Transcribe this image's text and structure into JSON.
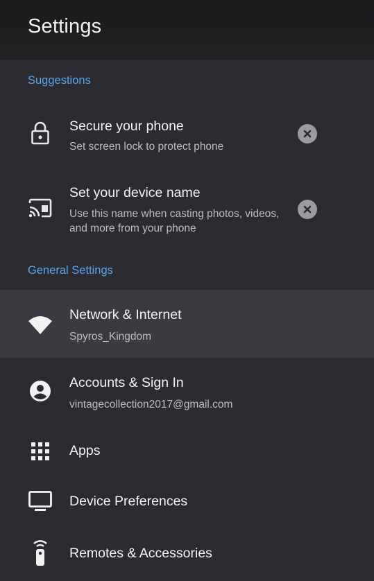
{
  "page": {
    "title": "Settings"
  },
  "suggestions": {
    "header": "Suggestions",
    "items": [
      {
        "title": "Secure your phone",
        "subtitle": "Set screen lock to protect phone",
        "icon": "lock-icon"
      },
      {
        "title": "Set your device name",
        "subtitle": "Use this name when casting photos, videos, and more from your phone",
        "icon": "cast-icon"
      }
    ]
  },
  "general": {
    "header": "General Settings",
    "items": [
      {
        "title": "Network & Internet",
        "subtitle": "Spyros_Kingdom",
        "icon": "wifi-icon"
      },
      {
        "title": "Accounts & Sign In",
        "subtitle": "vintagecollection2017@gmail.com",
        "icon": "account-icon"
      },
      {
        "title": "Apps",
        "icon": "apps-grid-icon"
      },
      {
        "title": "Device Preferences",
        "icon": "tv-icon"
      },
      {
        "title": "Remotes & Accessories",
        "icon": "remote-icon"
      }
    ]
  },
  "colors": {
    "accent": "#5aa5f0",
    "background": "#2c2b31",
    "header_bg": "#1d1d20",
    "selected_row": "#3b3a40"
  }
}
